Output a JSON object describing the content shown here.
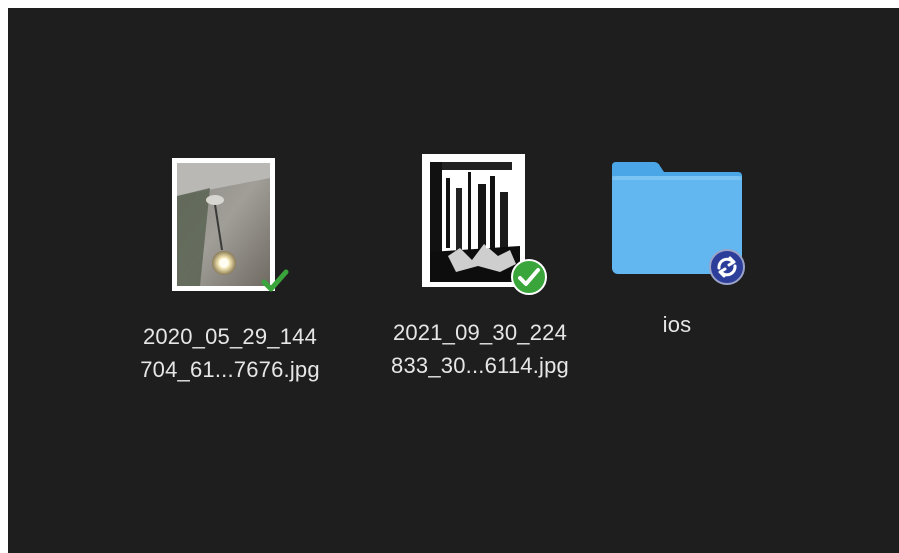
{
  "window": {
    "background": "#1f1e1f"
  },
  "files": [
    {
      "kind": "image",
      "name_line1": "2020_05_29_144",
      "name_line2": "704_61...7676.jpg",
      "status_icon": "check-icon"
    },
    {
      "kind": "image",
      "name_line1": "2021_09_30_224",
      "name_line2": "833_30...6114.jpg",
      "status_icon": "check-circle-icon"
    },
    {
      "kind": "folder",
      "name_line1": "ios",
      "status_icon": "sync-icon"
    }
  ],
  "colors": {
    "folder_blue": "#5ab4ec",
    "check_green": "#3aa53a",
    "sync_badge": "#2d3d9a",
    "label_text": "#e6e6e6"
  }
}
